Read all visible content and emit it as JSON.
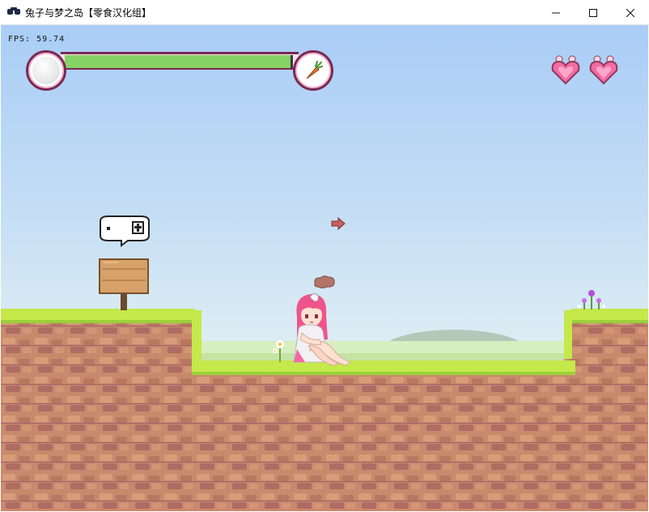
{
  "window": {
    "title": "兔子与梦之岛【零食汉化组】",
    "minimize_icon": "minimize-icon",
    "maximize_icon": "maximize-icon",
    "close_icon": "close-icon"
  },
  "hud": {
    "fps_text": "FPS: 59.74",
    "health_fraction": 0.99,
    "health_bar_color": "#86d264",
    "item_icon": "carrot-icon",
    "lives": [
      {
        "icon": "heart-icon"
      },
      {
        "icon": "heart-icon"
      }
    ]
  },
  "scene": {
    "sign_icon": "wooden-sign-icon",
    "speech_bubble_icon": "speech-bubble-icon",
    "arrow_icon": "arrow-right-icon",
    "floating_item_icon": "brown-cloud-icon",
    "character": "pink-haired-bunny-girl",
    "colors": {
      "sky_top": "#a9cdf6",
      "grass": "#c5e84a",
      "dirt": "#c4876a",
      "dirt_dark": "#a2606b"
    }
  }
}
